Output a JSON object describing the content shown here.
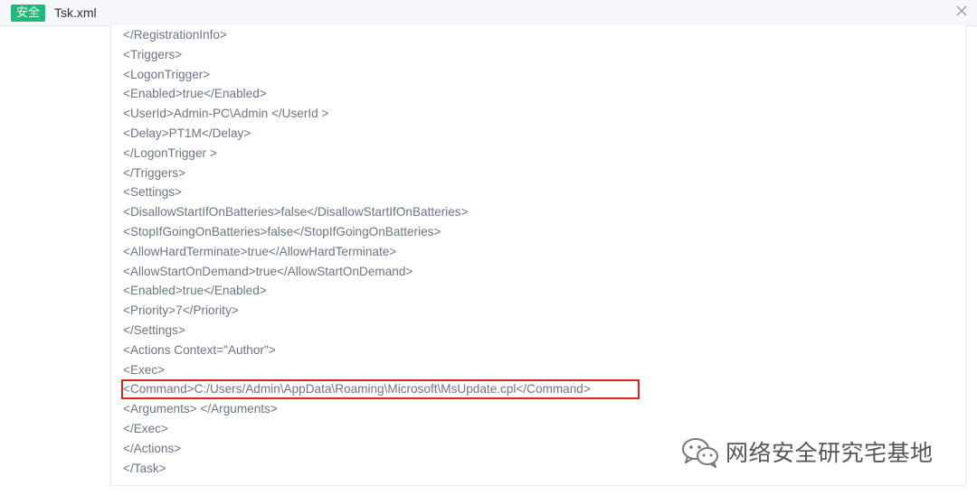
{
  "header": {
    "badge": "安全",
    "filename": "Tsk.xml"
  },
  "code": {
    "lines": [
      "</RegistrationInfo>",
      "<Triggers>",
      "<LogonTrigger>",
      "<Enabled>true</Enabled>",
      "<UserId>Admin-PC\\Admin </UserId >",
      "<Delay>PT1M</Delay>",
      "</LogonTrigger >",
      "</Triggers>",
      "<Settings>",
      "<DisallowStartIfOnBatteries>false</DisallowStartIfOnBatteries>",
      "<StopIfGoingOnBatteries>false</StopIfGoingOnBatteries>",
      "<AllowHardTerminate>true</AllowHardTerminate>",
      "<AllowStartOnDemand>true</AllowStartOnDemand>",
      "<Enabled>true</Enabled>",
      "<Priority>7</Priority>",
      "</Settings>",
      "<Actions Context=\"Author\">",
      "<Exec>",
      "<Command>C:/Users/Admin\\AppData\\Roaming\\Microsoft\\MsUpdate.cpl</Command>",
      "<Arguments> </Arguments>",
      "</Exec>",
      "</Actions>",
      "</Task>"
    ],
    "highlighted_line": 19
  },
  "watermark": {
    "text": "网络安全研究宅基地",
    "icon": "wechat-icon"
  },
  "colors": {
    "badge": "#1fb97a",
    "code_text": "#6b7684",
    "highlight": "#e02020"
  }
}
